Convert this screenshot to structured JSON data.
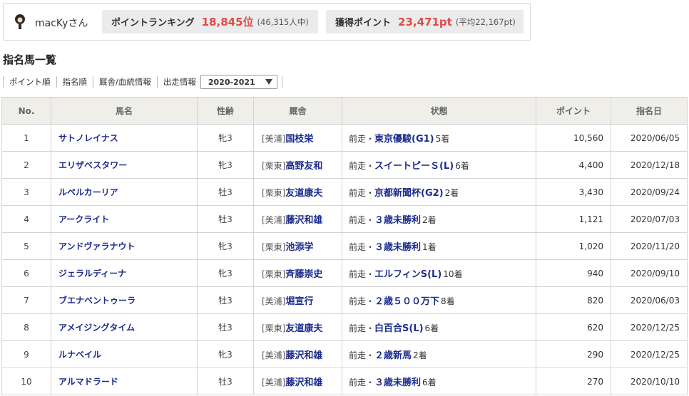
{
  "user": {
    "name": "macKyさん"
  },
  "ranking": {
    "label": "ポイントランキング",
    "value": "18,845位",
    "sub": "(46,315人中)"
  },
  "acquired": {
    "label": "獲得ポイント",
    "value": "23,471pt",
    "sub": "(平均22,167pt)"
  },
  "section_title": "指名馬一覧",
  "sort_options": [
    "ポイント順",
    "指名順",
    "厩舎/血統情報",
    "出走情報"
  ],
  "season_select": {
    "selected": "2020-2021"
  },
  "table": {
    "headers": {
      "no": "No.",
      "name": "馬名",
      "sex": "性齢",
      "stable": "厩舎",
      "status": "状態",
      "points": "ポイント",
      "date": "指名日"
    },
    "rows": [
      {
        "no": "1",
        "name": "サトノレイナス",
        "sex": "牝3",
        "region": "[美浦]",
        "trainer": "国枝栄",
        "prefix": "前走・",
        "race": "東京優駿(G1)",
        "place": "5着",
        "points": "10,560",
        "date": "2020/06/05"
      },
      {
        "no": "2",
        "name": "エリザベスタワー",
        "sex": "牝3",
        "region": "[栗東]",
        "trainer": "高野友和",
        "prefix": "前走・",
        "race": "スイートピーＳ(L)",
        "place": "6着",
        "points": "4,400",
        "date": "2020/12/18"
      },
      {
        "no": "3",
        "name": "ルペルカーリア",
        "sex": "牡3",
        "region": "[栗東]",
        "trainer": "友道康夫",
        "prefix": "前走・",
        "race": "京都新聞杯(G2)",
        "place": "2着",
        "points": "3,430",
        "date": "2020/09/24"
      },
      {
        "no": "4",
        "name": "アークライト",
        "sex": "牡3",
        "region": "[美浦]",
        "trainer": "藤沢和雄",
        "prefix": "前走・",
        "race": "３歳未勝利",
        "place": "2着",
        "points": "1,121",
        "date": "2020/07/03"
      },
      {
        "no": "5",
        "name": "アンドヴァラナウト",
        "sex": "牝3",
        "region": "[栗東]",
        "trainer": "池添学",
        "prefix": "前走・",
        "race": "３歳未勝利",
        "place": "1着",
        "points": "1,020",
        "date": "2020/11/20"
      },
      {
        "no": "6",
        "name": "ジェラルディーナ",
        "sex": "牝3",
        "region": "[栗東]",
        "trainer": "斉藤崇史",
        "prefix": "前走・",
        "race": "エルフィンS(L)",
        "place": "10着",
        "points": "940",
        "date": "2020/09/10"
      },
      {
        "no": "7",
        "name": "ブエナベントゥーラ",
        "sex": "牡3",
        "region": "[美浦]",
        "trainer": "堀宣行",
        "prefix": "前走・",
        "race": "２歳５００万下",
        "place": "8着",
        "points": "820",
        "date": "2020/06/03"
      },
      {
        "no": "8",
        "name": "アメイジングタイム",
        "sex": "牡3",
        "region": "[栗東]",
        "trainer": "友道康夫",
        "prefix": "前走・",
        "race": "白百合S(L)",
        "place": "6着",
        "points": "620",
        "date": "2020/12/25"
      },
      {
        "no": "9",
        "name": "ルナベイル",
        "sex": "牝3",
        "region": "[美浦]",
        "trainer": "藤沢和雄",
        "prefix": "前走・",
        "race": "２歳新馬",
        "place": "2着",
        "points": "290",
        "date": "2020/12/25"
      },
      {
        "no": "10",
        "name": "アルマドラード",
        "sex": "牡3",
        "region": "[美浦]",
        "trainer": "藤沢和雄",
        "prefix": "前走・",
        "race": "３歳未勝利",
        "place": "6着",
        "points": "270",
        "date": "2020/10/10"
      }
    ]
  },
  "colors": {
    "accent_red": "#e04a4a",
    "link_blue": "#1d2c8c",
    "header_bg": "#efeee8",
    "stat_bg": "#ebebeb"
  },
  "icons": {
    "avatar": "user-avatar-icon",
    "select": "triangle-down-icon"
  }
}
